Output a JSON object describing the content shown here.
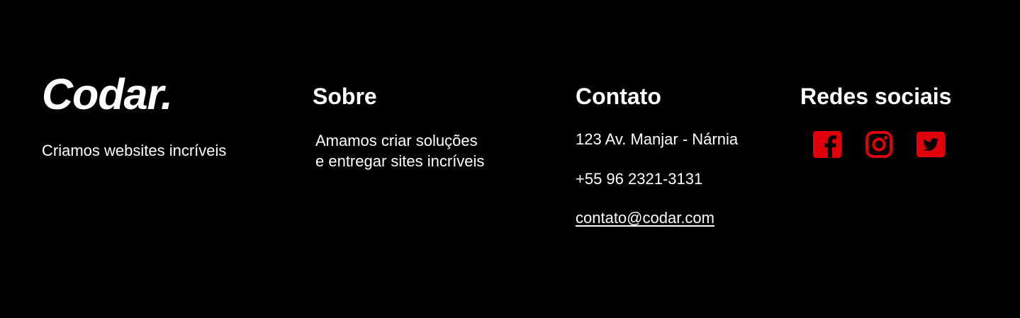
{
  "brand": {
    "logo": "Codar.",
    "tagline": "Criamos websites incríveis"
  },
  "about": {
    "heading": "Sobre",
    "lines": [
      "Amamos criar soluções",
      "e entregar sites incríveis"
    ]
  },
  "contact": {
    "heading": "Contato",
    "address": "123 Av. Manjar - Nárnia",
    "phone": "+55 96 2321-3131",
    "email": "contato@codar.com"
  },
  "social": {
    "heading": "Redes sociais",
    "icons": [
      "facebook-icon",
      "instagram-icon",
      "twitter-icon"
    ],
    "icon_color": "#e0000b"
  },
  "colors": {
    "background": "#000000",
    "text": "#ffffff",
    "accent": "#e0000b"
  }
}
